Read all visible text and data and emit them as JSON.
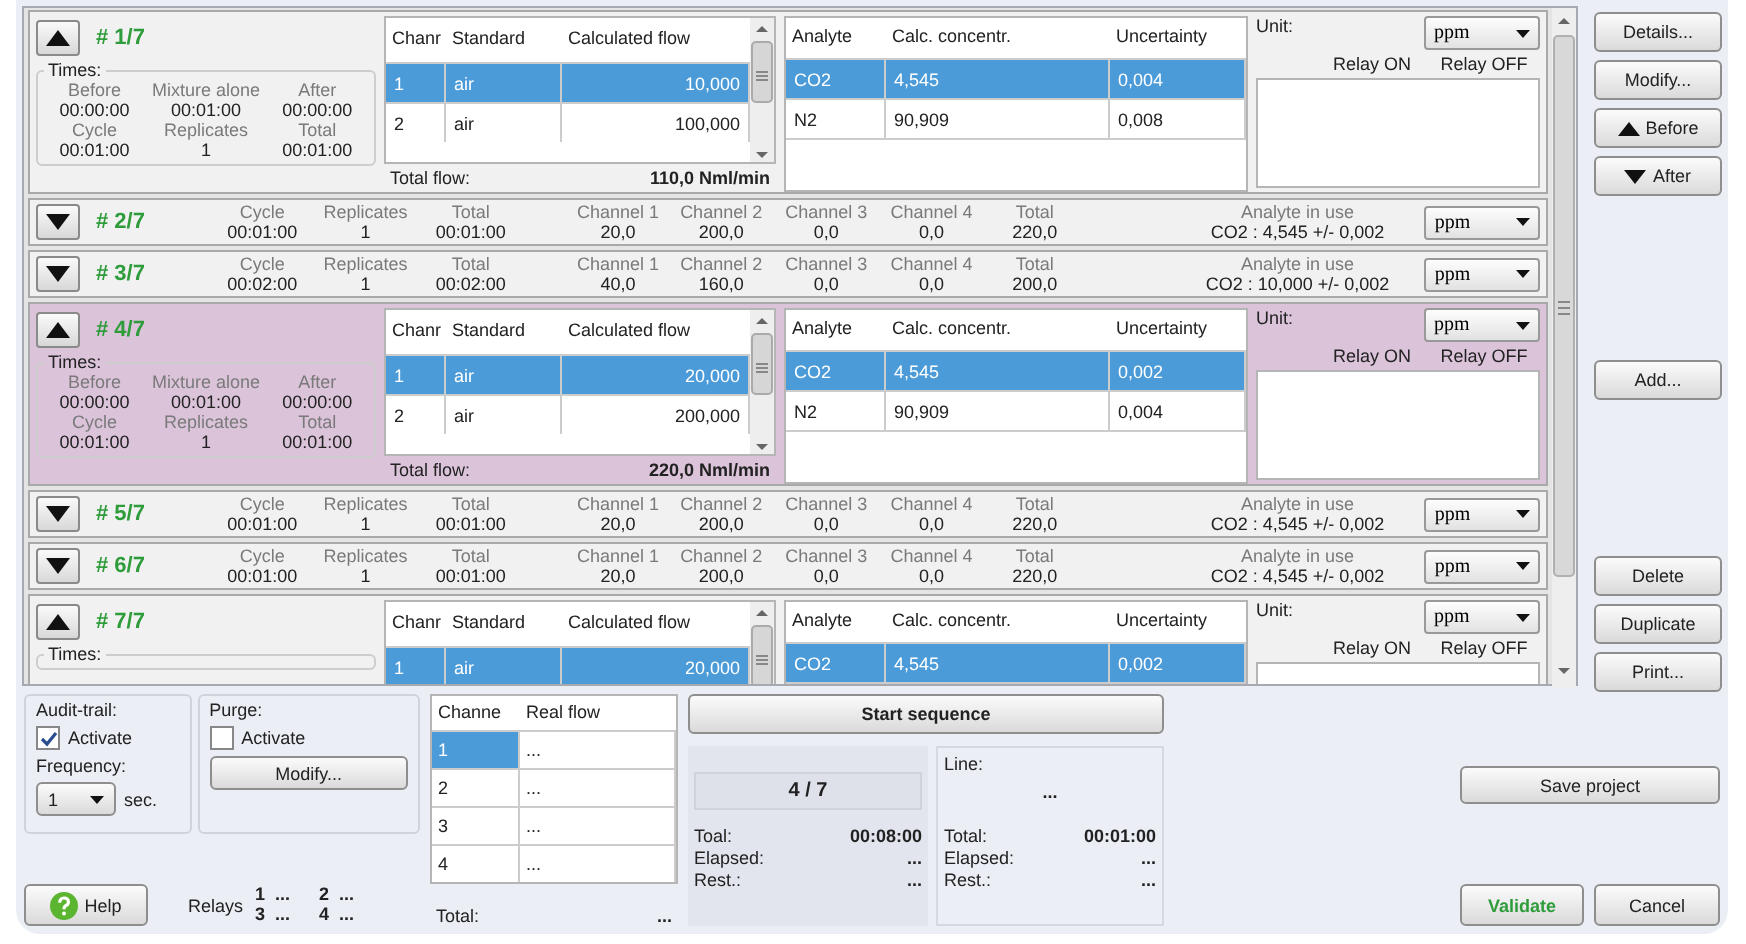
{
  "sequence": {
    "rows": [
      {
        "number": "# 1/7",
        "selected": false,
        "expanded": true,
        "times": {
          "title": "Times:",
          "fields": [
            {
              "label": "Before",
              "value": "00:00:00"
            },
            {
              "label": "Mixture alone",
              "value": "00:01:00"
            },
            {
              "label": "After",
              "value": "00:00:00"
            },
            {
              "label": "Cycle",
              "value": "00:01:00"
            },
            {
              "label": "Replicates",
              "value": "1"
            },
            {
              "label": "Total",
              "value": "00:01:00"
            }
          ]
        },
        "flow_table": {
          "columns": [
            "Chanr",
            "Standard",
            "Calculated flow"
          ],
          "rows": [
            {
              "channel": "1",
              "standard": "air",
              "flow": "10,000",
              "selected": true
            },
            {
              "channel": "2",
              "standard": "air",
              "flow": "100,000",
              "selected": false
            }
          ],
          "total_label": "Total flow:",
          "total_value": "110,0 Nml/min"
        },
        "analyte_table": {
          "columns": [
            "Analyte",
            "Calc. concentr.",
            "Uncertainty"
          ],
          "rows": [
            {
              "analyte": "CO2",
              "concentration": "4,545",
              "uncertainty": "0,004",
              "selected": true
            },
            {
              "analyte": "N2",
              "concentration": "90,909",
              "uncertainty": "0,008",
              "selected": false
            }
          ]
        },
        "unit_label": "Unit:",
        "unit": "ppm",
        "relay_columns": [
          "Relay ON",
          "Relay OFF"
        ]
      },
      {
        "number": "# 2/7",
        "selected": false,
        "expanded": false,
        "fields": [
          {
            "label": "Cycle",
            "value": "00:01:00"
          },
          {
            "label": "Replicates",
            "value": "1"
          },
          {
            "label": "Total",
            "value": "00:01:00"
          },
          {
            "label": "Channel 1",
            "value": "20,0"
          },
          {
            "label": "Channel 2",
            "value": "200,0"
          },
          {
            "label": "Channel 3",
            "value": "0,0"
          },
          {
            "label": "Channel 4",
            "value": "0,0"
          },
          {
            "label": "Total",
            "value": "220,0"
          }
        ],
        "analyte": {
          "label": "Analyte in use",
          "value": "CO2 : 4,545 +/- 0,002"
        },
        "unit": "ppm"
      },
      {
        "number": "# 3/7",
        "selected": false,
        "expanded": false,
        "fields": [
          {
            "label": "Cycle",
            "value": "00:02:00"
          },
          {
            "label": "Replicates",
            "value": "1"
          },
          {
            "label": "Total",
            "value": "00:02:00"
          },
          {
            "label": "Channel 1",
            "value": "40,0"
          },
          {
            "label": "Channel 2",
            "value": "160,0"
          },
          {
            "label": "Channel 3",
            "value": "0,0"
          },
          {
            "label": "Channel 4",
            "value": "0,0"
          },
          {
            "label": "Total",
            "value": "200,0"
          }
        ],
        "analyte": {
          "label": "Analyte in use",
          "value": "CO2 : 10,000 +/- 0,002"
        },
        "unit": "ppm"
      },
      {
        "number": "# 4/7",
        "selected": true,
        "expanded": true,
        "times": {
          "title": "Times:",
          "fields": [
            {
              "label": "Before",
              "value": "00:00:00"
            },
            {
              "label": "Mixture alone",
              "value": "00:01:00"
            },
            {
              "label": "After",
              "value": "00:00:00"
            },
            {
              "label": "Cycle",
              "value": "00:01:00"
            },
            {
              "label": "Replicates",
              "value": "1"
            },
            {
              "label": "Total",
              "value": "00:01:00"
            }
          ]
        },
        "flow_table": {
          "columns": [
            "Chanr",
            "Standard",
            "Calculated flow"
          ],
          "rows": [
            {
              "channel": "1",
              "standard": "air",
              "flow": "20,000",
              "selected": true
            },
            {
              "channel": "2",
              "standard": "air",
              "flow": "200,000",
              "selected": false
            }
          ],
          "total_label": "Total flow:",
          "total_value": "220,0 Nml/min"
        },
        "analyte_table": {
          "columns": [
            "Analyte",
            "Calc. concentr.",
            "Uncertainty"
          ],
          "rows": [
            {
              "analyte": "CO2",
              "concentration": "4,545",
              "uncertainty": "0,002",
              "selected": true
            },
            {
              "analyte": "N2",
              "concentration": "90,909",
              "uncertainty": "0,004",
              "selected": false
            }
          ]
        },
        "unit_label": "Unit:",
        "unit": "ppm",
        "relay_columns": [
          "Relay ON",
          "Relay OFF"
        ]
      },
      {
        "number": "# 5/7",
        "selected": false,
        "expanded": false,
        "fields": [
          {
            "label": "Cycle",
            "value": "00:01:00"
          },
          {
            "label": "Replicates",
            "value": "1"
          },
          {
            "label": "Total",
            "value": "00:01:00"
          },
          {
            "label": "Channel 1",
            "value": "20,0"
          },
          {
            "label": "Channel 2",
            "value": "200,0"
          },
          {
            "label": "Channel 3",
            "value": "0,0"
          },
          {
            "label": "Channel 4",
            "value": "0,0"
          },
          {
            "label": "Total",
            "value": "220,0"
          }
        ],
        "analyte": {
          "label": "Analyte in use",
          "value": "CO2 : 4,545 +/- 0,002"
        },
        "unit": "ppm"
      },
      {
        "number": "# 6/7",
        "selected": false,
        "expanded": false,
        "fields": [
          {
            "label": "Cycle",
            "value": "00:01:00"
          },
          {
            "label": "Replicates",
            "value": "1"
          },
          {
            "label": "Total",
            "value": "00:01:00"
          },
          {
            "label": "Channel 1",
            "value": "20,0"
          },
          {
            "label": "Channel 2",
            "value": "200,0"
          },
          {
            "label": "Channel 3",
            "value": "0,0"
          },
          {
            "label": "Channel 4",
            "value": "0,0"
          },
          {
            "label": "Total",
            "value": "220,0"
          }
        ],
        "analyte": {
          "label": "Analyte in use",
          "value": "CO2 : 4,545 +/- 0,002"
        },
        "unit": "ppm"
      },
      {
        "number": "# 7/7",
        "selected": false,
        "expanded": true,
        "times": {
          "title": "Times:"
        },
        "flow_table": {
          "columns": [
            "Chanr",
            "Standard",
            "Calculated flow"
          ],
          "rows": [
            {
              "channel": "1",
              "standard": "air",
              "flow": "20,000",
              "selected": true
            }
          ]
        },
        "analyte_table": {
          "columns": [
            "Analyte",
            "Calc. concentr.",
            "Uncertainty"
          ],
          "rows": [
            {
              "analyte": "CO2",
              "concentration": "4,545",
              "uncertainty": "0,002",
              "selected": true
            }
          ]
        },
        "unit_label": "Unit:",
        "unit": "ppm",
        "relay_columns": [
          "Relay ON",
          "Relay OFF"
        ]
      }
    ]
  },
  "side_buttons": [
    [
      {
        "label": "Details...",
        "kind": "plain"
      },
      {
        "label": "Modify...",
        "kind": "plain"
      },
      {
        "label": "Before",
        "kind": "up"
      },
      {
        "label": "After",
        "kind": "down"
      }
    ],
    [
      {
        "label": "Add...",
        "kind": "plain"
      }
    ],
    [
      {
        "label": "Delete",
        "kind": "plain"
      },
      {
        "label": "Duplicate",
        "kind": "plain"
      },
      {
        "label": "Print...",
        "kind": "plain"
      }
    ]
  ],
  "audit_trail": {
    "title": "Audit-trail:",
    "activate": {
      "label": "Activate",
      "checked": true
    },
    "frequency_label": "Frequency:",
    "frequency": "1",
    "unit": "sec."
  },
  "purge": {
    "title": "Purge:",
    "activate": {
      "label": "Activate",
      "checked": false
    },
    "button": "Modify..."
  },
  "help_button": "Help",
  "relays": {
    "label": "Relays",
    "items": [
      {
        "number": "1",
        "value": "..."
      },
      {
        "number": "2",
        "value": "..."
      },
      {
        "number": "3",
        "value": "..."
      },
      {
        "number": "4",
        "value": "..."
      }
    ]
  },
  "real_flow": {
    "columns": [
      "Channe",
      "Real flow"
    ],
    "rows": [
      {
        "channel": "1",
        "flow": "...",
        "selected": true
      },
      {
        "channel": "2",
        "flow": "...",
        "selected": false
      },
      {
        "channel": "3",
        "flow": "...",
        "selected": false
      },
      {
        "channel": "4",
        "flow": "...",
        "selected": false
      }
    ],
    "total_label": "Total:",
    "total_value": "..."
  },
  "start_button": "Start sequence",
  "progress": {
    "position": "4 / 7",
    "rows": [
      {
        "label": "Toal:",
        "value": "00:08:00"
      },
      {
        "label": "Elapsed:",
        "value": "..."
      },
      {
        "label": "Rest.:",
        "value": "..."
      }
    ]
  },
  "line": {
    "title": "Line:",
    "value": "...",
    "rows": [
      {
        "label": "Total:",
        "value": "00:01:00"
      },
      {
        "label": "Elapsed:",
        "value": "..."
      },
      {
        "label": "Rest.:",
        "value": "..."
      }
    ]
  },
  "save_button": "Save project",
  "validate_button": "Validate",
  "cancel_button": "Cancel"
}
